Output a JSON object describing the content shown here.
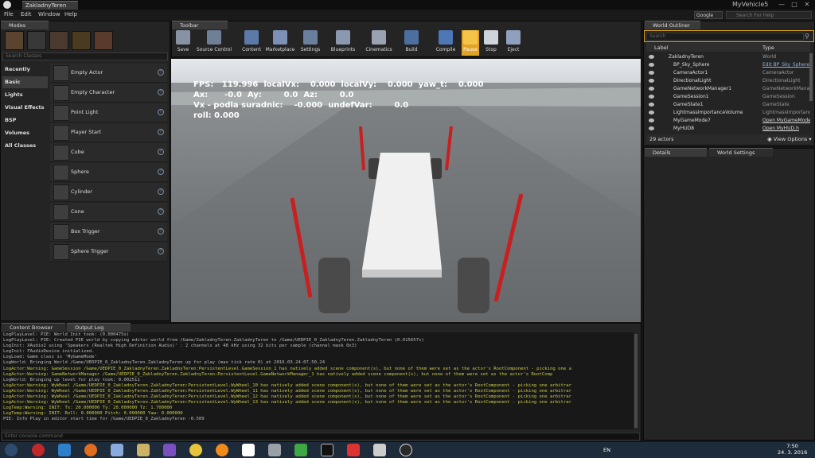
{
  "window": {
    "doc_tab": "ZakladnyTeren",
    "app_title": "MyVehicle5",
    "minimize": "—",
    "restore": "□",
    "close": "✕"
  },
  "menu": [
    "File",
    "Edit",
    "Window",
    "Help"
  ],
  "search": {
    "engine": "Google",
    "placeholder": "Search For Help"
  },
  "modes": {
    "tab_label": "Modes",
    "search_placeholder": "Search Classes",
    "categories": [
      "Recently Placed",
      "Basic",
      "Lights",
      "Visual Effects",
      "BSP",
      "Volumes",
      "All Classes"
    ],
    "selected_category": "Basic",
    "items": [
      "Empty Actor",
      "Empty Character",
      "Point Light",
      "Player Start",
      "Cube",
      "Sphere",
      "Cylinder",
      "Cone",
      "Box Trigger",
      "Sphere Trigger"
    ]
  },
  "toolbar": {
    "tab_label": "Toolbar",
    "buttons": [
      "Save",
      "Source Control",
      "Content",
      "Marketplace",
      "Settings",
      "Blueprints",
      "Cinematics",
      "Build",
      "Compile",
      "Pause",
      "Stop",
      "Eject"
    ],
    "active_button": "Pause"
  },
  "hud": {
    "line1": "FPS:   119.996  localVx:    0.000  localVy:    0.000  yaw_t:    0.000",
    "line2": "Ax:      -0.0  Ay:        0.0  Az:        0.0",
    "line3": "Vx - podla suradnic:    -0.000  undefVar:        0.0",
    "line4": "roll: 0.000"
  },
  "outliner": {
    "tab_label": "World Outliner",
    "search_placeholder": "Search",
    "col_label": "Label",
    "col_type": "Type",
    "rows": [
      {
        "label": "ZakladnyTeren",
        "type": "World",
        "style": "type"
      },
      {
        "label": "BP_Sky_Sphere",
        "type": "Edit BP_Sky_Sphere",
        "style": "link"
      },
      {
        "label": "CameraActor1",
        "type": "CameraActor",
        "style": "type"
      },
      {
        "label": "DirectionalLight",
        "type": "DirectionalLight",
        "style": "type"
      },
      {
        "label": "GameNetworkManager1",
        "type": "GameNetworkManager",
        "style": "type"
      },
      {
        "label": "GameSession1",
        "type": "GameSession",
        "style": "type"
      },
      {
        "label": "GameState1",
        "type": "GameState",
        "style": "type"
      },
      {
        "label": "LightmassImportanceVolume",
        "type": "LightmassImportanceVolume",
        "style": "type"
      },
      {
        "label": "MyGameMode7",
        "type": "Open MyGameMode",
        "style": "plain"
      },
      {
        "label": "MyHUD8",
        "type": "Open MyHUD.h",
        "style": "plain"
      }
    ],
    "actor_count": "29 actors",
    "view_options": "View Options"
  },
  "details": {
    "tab_details": "Details",
    "tab_world_settings": "World Settings"
  },
  "bottom": {
    "tab_content_browser": "Content Browser",
    "tab_output_log": "Output Log"
  },
  "log": [
    {
      "text": "LogPlayLevel: PIE: World Init took: (0.000475s)",
      "kind": "n"
    },
    {
      "text": "LogPlayLevel: PIE: Created PIE world by copying editor world from /Game/ZakladnyTeren.ZakladnyTeren to /Game/UEDPIE_0_ZakladnyTeren.ZakladnyTeren (0.015657s)",
      "kind": "n"
    },
    {
      "text": "LogInit: XAudio2 using 'Speakers (Realtek High Definition Audio)' : 2 channels at 48 kHz using 32 bits per sample (channel mask 0x3)",
      "kind": "n"
    },
    {
      "text": "LogInit: FAudioDevice initialized.",
      "kind": "n"
    },
    {
      "text": "LogLoad: Game class is 'MyGameMode'",
      "kind": "n"
    },
    {
      "text": "LogWorld: Bringing World /Game/UEDPIE_0_ZakladnyTeren.ZakladnyTeren up for play (max tick rate 0) at 2016.03.24-07.50.24",
      "kind": "n"
    },
    {
      "text": "LogActor:Warning: GameSession /Game/UEDPIE_0_ZakladnyTeren.ZakladnyTeren:PersistentLevel.GameSession_1 has natively added scene component(s), but none of them were set as the actor's RootComponent - picking one a",
      "kind": "w"
    },
    {
      "text": "LogActor:Warning: GameNetworkManager /Game/UEDPIE_0_ZakladnyTeren.ZakladnyTeren:PersistentLevel.GameNetworkManager_1 has natively added scene component(s), but none of them were set as the actor's RootComp",
      "kind": "w"
    },
    {
      "text": "LogWorld: Bringing up level for play took: 0.002511",
      "kind": "n"
    },
    {
      "text": "LogActor:Warning: WyWheel /Game/UEDPIE_0_ZakladnyTeren.ZakladnyTeren:PersistentLevel.WyWheel_10 has natively added scene component(s), but none of them were set as the actor's RootComponent - picking one arbitrar",
      "kind": "w"
    },
    {
      "text": "LogActor:Warning: WyWheel /Game/UEDPIE_0_ZakladnyTeren.ZakladnyTeren:PersistentLevel.WyWheel_11 has natively added scene component(s), but none of them were set as the actor's RootComponent - picking one arbitrar",
      "kind": "w"
    },
    {
      "text": "LogActor:Warning: WyWheel /Game/UEDPIE_0_ZakladnyTeren.ZakladnyTeren:PersistentLevel.WyWheel_12 has natively added scene component(s), but none of them were set as the actor's RootComponent - picking one arbitrar",
      "kind": "w"
    },
    {
      "text": "LogActor:Warning: WyWheel /Game/UEDPIE_0_ZakladnyTeren.ZakladnyTeren:PersistentLevel.WyWheel_13 has natively added scene component(s), but none of them were set as the actor's RootComponent - picking one arbitrar",
      "kind": "w"
    },
    {
      "text": "LogTemp:Warning: INIT: Tx: 20.000000 Ty: 20.000000 Tz: 1.700000",
      "kind": "w"
    },
    {
      "text": "LogTemp:Warning: INIT: Roll: 0.000000 Pitch: 0.000000 Yaw: 0.000000",
      "kind": "w"
    },
    {
      "text": "PIE: Info Play in editor start time for /Game/UEDPIE_0_ZakladnyTeren -0.509",
      "kind": "n"
    }
  ],
  "console_placeholder": "Enter console command",
  "tray": {
    "lang": "EN",
    "time": "7:50",
    "date": "24. 3. 2016"
  }
}
